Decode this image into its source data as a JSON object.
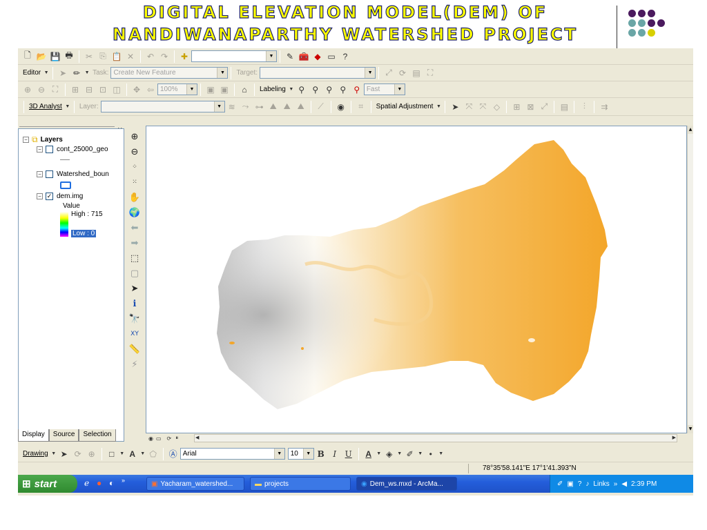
{
  "slide": {
    "title_line1": "DIGITAL ELEVATION MODEL(DEM) OF",
    "title_line2": "NANDIWANAPARTHY WATERSHED PROJECT",
    "dot_colors": [
      "#4b1a5e",
      "#4b1a5e",
      "#4b1a5e",
      "#4b1a5e",
      "#6aa6a6",
      "#6aa6a6",
      "#4b1a5e",
      "#6aa6a6",
      "#6aa6a6",
      "#d8d000"
    ]
  },
  "toolbar_editor": {
    "editor_label": "Editor",
    "task_label": "Task:",
    "task_value": "Create New Feature",
    "target_label": "Target:"
  },
  "toolbar_view": {
    "zoom_value": "100%",
    "labeling_label": "Labeling",
    "fast_value": "Fast"
  },
  "toolbar_analyst": {
    "analyst_label": "3D Analyst",
    "layer_label": "Layer:",
    "spatial_label": "Spatial Adjustment"
  },
  "toc": {
    "root_label": "Layers",
    "layers": [
      {
        "name": "cont_25000_geo",
        "checked": false
      },
      {
        "name": "Watershed_boun",
        "checked": false
      },
      {
        "name": "dem.img",
        "checked": true
      }
    ],
    "value_label": "Value",
    "high_label": "High : 715",
    "low_label": "Low : 0",
    "tabs": [
      "Display",
      "Source",
      "Selection"
    ]
  },
  "drawing": {
    "drawing_label": "Drawing",
    "font_value": "Arial",
    "size_value": "10",
    "bold": "B",
    "italic": "I",
    "underline": "U"
  },
  "status": {
    "coordinates": "78°35'58.141\"E  17°1'41.393\"N"
  },
  "taskbar": {
    "start_label": "start",
    "tasks": [
      "Yacharam_watershed...",
      "projects",
      "Dem_ws.mxd - ArcMa..."
    ],
    "links_label": "Links",
    "clock": "2:39 PM"
  }
}
